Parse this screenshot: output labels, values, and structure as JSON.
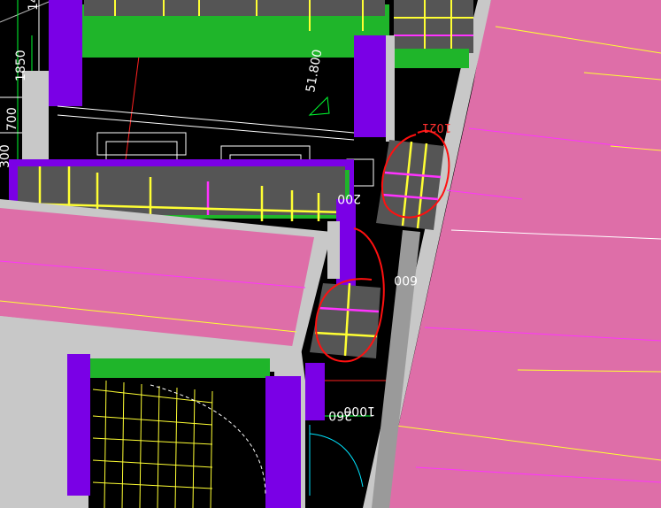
{
  "drawing": {
    "dimension_labels": {
      "d1850": "1850",
      "d51800": "51.800",
      "d700": "700",
      "d300": "300",
      "d200": "200",
      "d600": "600",
      "d260": "260",
      "d1000": "1000",
      "d1021": "1021",
      "d14": "14"
    },
    "colors": {
      "background": "#000000",
      "roof_pink": "#de6ea8",
      "wall_gray": "#c8c8c8",
      "column_purple": "#7a00e6",
      "beam_green": "#1fb52a",
      "window_dark": "#555555",
      "grid_yellow": "#ffff33",
      "grid_magenta": "#ff33ff",
      "markup_red": "#ff1010",
      "cyan": "#00e5ff"
    }
  }
}
